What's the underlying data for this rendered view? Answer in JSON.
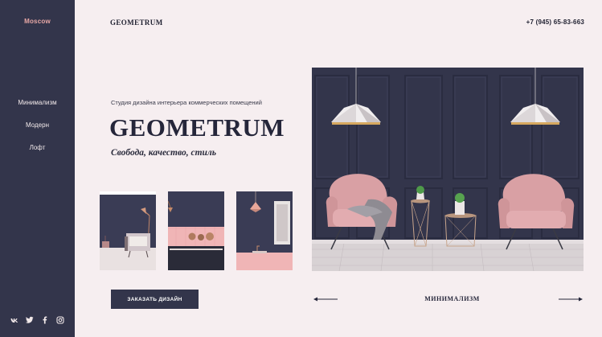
{
  "sidebar": {
    "city": "Moscow",
    "nav": [
      {
        "label": "Минимализм"
      },
      {
        "label": "Модерн"
      },
      {
        "label": "Лофт"
      }
    ],
    "socials": [
      "vk-icon",
      "twitter-icon",
      "facebook-icon",
      "instagram-icon"
    ]
  },
  "header": {
    "brand": "GEOMETRUM",
    "phone": "+7 (945) 65-83-663"
  },
  "hero": {
    "subtitle": "Студия дизайна интерьера коммерческих помещений",
    "title": "GEOMETRUM",
    "tagline": "Свобода, качество, стиль",
    "cta_label": "ЗАКАЗАТЬ ДИЗАЙН"
  },
  "slider": {
    "current_label": "МИНИМАЛИЗМ",
    "prev_icon": "arrow-left-icon",
    "next_icon": "arrow-right-icon"
  },
  "colors": {
    "sidebar": "#33354b",
    "background": "#f6eef0",
    "accent": "#e7a7a5",
    "wall": "#33354b",
    "chair": "#d9a0a4"
  }
}
